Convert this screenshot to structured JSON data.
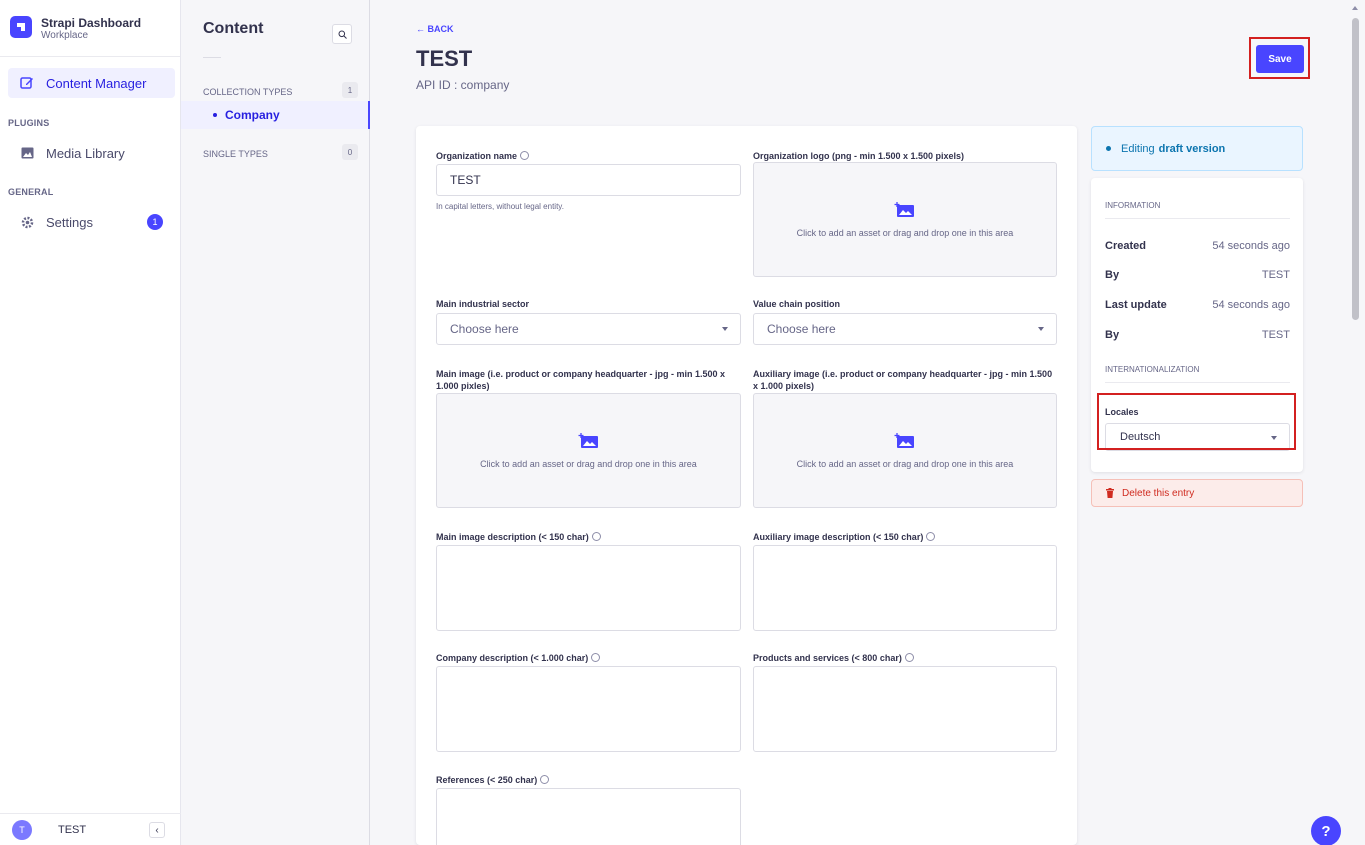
{
  "brand": {
    "title": "Strapi Dashboard",
    "subtitle": "Workplace",
    "logo": "strapi-logo"
  },
  "mainnav": {
    "content_manager": "Content Manager",
    "plugins_section": "PLUGINS",
    "media_library": "Media Library",
    "general_section": "GENERAL",
    "settings": "Settings",
    "settings_badge": "1"
  },
  "user": {
    "initial": "T",
    "name": "TEST"
  },
  "subnav": {
    "title": "Content",
    "collection_types": "COLLECTION TYPES",
    "collection_count": "1",
    "company": "Company",
    "single_types": "SINGLE TYPES",
    "single_count": "0"
  },
  "header": {
    "back": "BACK",
    "title": "TEST",
    "api_id": "API ID : company",
    "save": "Save"
  },
  "form": {
    "org_name_label": "Organization name",
    "org_name_value": "TEST",
    "org_name_hint": "In capital letters, without legal entity.",
    "org_logo_label": "Organization logo (png - min 1.500 x 1.500 pixels)",
    "asset_prompt": "Click to add an asset or drag and drop one in this area",
    "sector_label": "Main industrial sector",
    "sector_placeholder": "Choose here",
    "value_chain_label": "Value chain position",
    "value_chain_placeholder": "Choose here",
    "main_image_label": "Main image (i.e. product or company headquarter - jpg - min 1.500 x 1.000 pixles)",
    "aux_image_label": "Auxiliary image (i.e. product or company headquarter - jpg - min 1.500 x 1.000 pixels)",
    "main_desc_label": "Main image description (< 150 char)",
    "aux_desc_label": "Auxiliary image description (< 150 char)",
    "company_desc_label": "Company description (< 1.000 char)",
    "products_label": "Products and services (< 800 char)",
    "references_label": "References (< 250 char)"
  },
  "side": {
    "draft_prefix": "Editing",
    "draft_bold": "draft version",
    "information": "INFORMATION",
    "created_k": "Created",
    "created_v": "54 seconds ago",
    "by1_k": "By",
    "by1_v": "TEST",
    "updated_k": "Last update",
    "updated_v": "54 seconds ago",
    "by2_k": "By",
    "by2_v": "TEST",
    "i18n": "INTERNATIONALIZATION",
    "locales_label": "Locales",
    "locale_value": "Deutsch",
    "delete": "Delete this entry"
  },
  "help": "?",
  "colors": {
    "primary": "#4945ff",
    "danger": "#d02b20",
    "highlight": "#d32020"
  }
}
